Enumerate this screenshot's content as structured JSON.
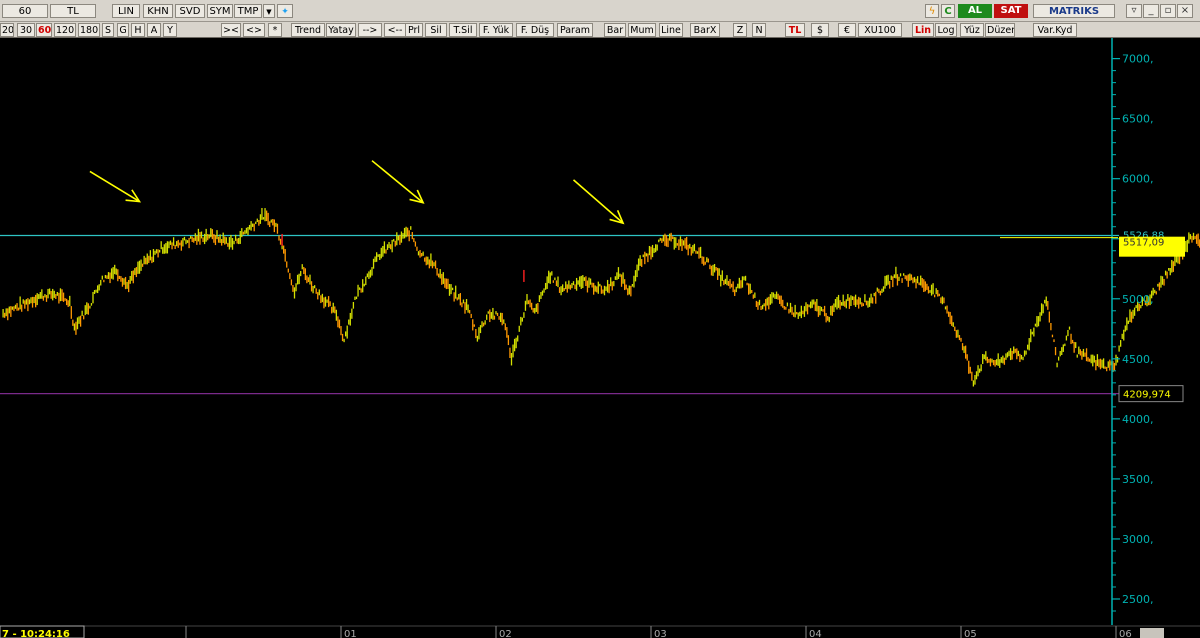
{
  "toolbar_top": {
    "period": "60",
    "currency": "TL",
    "buttons": [
      "LIN",
      "KHN",
      "SVD",
      "SYM",
      "TMP"
    ],
    "buy": "AL",
    "sell": "SAT",
    "brand": "MATRIKS",
    "brand_color": "#1a3a8a",
    "buy_color": "#1d8a1d",
    "sell_color": "#c01010"
  },
  "toolbar_periods": [
    "20",
    "30",
    "60",
    "120",
    "180",
    "S",
    "G",
    "H",
    "A",
    "Y"
  ],
  "active_period": "60",
  "toolbar_tools": [
    "><",
    "<>",
    "*",
    "Trend",
    "Yatay",
    "-->",
    "<--",
    "Prl",
    "Sil",
    "T.Sil",
    "F. Yük",
    "F. Düş",
    "Param",
    "Bar",
    "Mum",
    "Line",
    "BarX",
    "Z",
    "N",
    "TL",
    "$",
    "€",
    "XU100",
    "Lin",
    "Log",
    "Yüz",
    "Düzen",
    "Var.Kyd"
  ],
  "status": {
    "time": "7 - 10:24:16"
  },
  "chart_data": {
    "type": "line",
    "symbol": "XU100",
    "scale": "linear",
    "ylim": [
      2350,
      7130
    ],
    "y_ticks": [
      7000,
      6500,
      6000,
      5500,
      5000,
      4500,
      4000,
      3500,
      3000,
      2500
    ],
    "y_tick_labels": [
      "7000,",
      "6500,",
      "6000,",
      "5500,",
      "5000,",
      "4500,",
      "4000,",
      "3500,",
      "3000,",
      "2500,"
    ],
    "x_ticks": [
      {
        "x": 0.0,
        "label": ""
      },
      {
        "x": 1.0,
        "label": "01"
      },
      {
        "x": 2.0,
        "label": "02"
      },
      {
        "x": 3.0,
        "label": "03"
      },
      {
        "x": 4.0,
        "label": "04"
      },
      {
        "x": 5.0,
        "label": "05"
      },
      {
        "x": 6.0,
        "label": "06"
      }
    ],
    "series": [
      {
        "values": [
          [
            -1.18,
            4880
          ],
          [
            -1.05,
            4950
          ],
          [
            -0.95,
            5020
          ],
          [
            -0.85,
            5040
          ],
          [
            -0.75,
            4970
          ],
          [
            -0.72,
            4760
          ],
          [
            -0.62,
            4950
          ],
          [
            -0.55,
            5150
          ],
          [
            -0.45,
            5240
          ],
          [
            -0.38,
            5110
          ],
          [
            -0.3,
            5260
          ],
          [
            -0.15,
            5430
          ],
          [
            0.0,
            5480
          ],
          [
            0.15,
            5530
          ],
          [
            0.3,
            5460
          ],
          [
            0.4,
            5580
          ],
          [
            0.5,
            5690
          ],
          [
            0.58,
            5610
          ],
          [
            0.62,
            5460
          ],
          [
            0.7,
            5060
          ],
          [
            0.75,
            5250
          ],
          [
            0.82,
            5100
          ],
          [
            0.9,
            4980
          ],
          [
            0.97,
            4870
          ],
          [
            1.02,
            4660
          ],
          [
            1.1,
            5030
          ],
          [
            1.25,
            5370
          ],
          [
            1.4,
            5520
          ],
          [
            1.45,
            5560
          ],
          [
            1.5,
            5400
          ],
          [
            1.6,
            5280
          ],
          [
            1.7,
            5080
          ],
          [
            1.82,
            4920
          ],
          [
            1.88,
            4690
          ],
          [
            1.95,
            4880
          ],
          [
            2.05,
            4830
          ],
          [
            2.1,
            4510
          ],
          [
            2.2,
            4980
          ],
          [
            2.25,
            4880
          ],
          [
            2.35,
            5200
          ],
          [
            2.42,
            5080
          ],
          [
            2.55,
            5150
          ],
          [
            2.7,
            5070
          ],
          [
            2.8,
            5200
          ],
          [
            2.86,
            5050
          ],
          [
            2.93,
            5300
          ],
          [
            3.05,
            5470
          ],
          [
            3.15,
            5490
          ],
          [
            3.3,
            5390
          ],
          [
            3.45,
            5180
          ],
          [
            3.55,
            5060
          ],
          [
            3.6,
            5170
          ],
          [
            3.7,
            4940
          ],
          [
            3.8,
            5010
          ],
          [
            3.95,
            4860
          ],
          [
            4.05,
            4950
          ],
          [
            4.15,
            4850
          ],
          [
            4.2,
            4960
          ],
          [
            4.3,
            5000
          ],
          [
            4.4,
            4970
          ],
          [
            4.5,
            5100
          ],
          [
            4.58,
            5190
          ],
          [
            4.7,
            5160
          ],
          [
            4.8,
            5090
          ],
          [
            4.9,
            4950
          ],
          [
            4.95,
            4790
          ],
          [
            5.02,
            4580
          ],
          [
            5.08,
            4320
          ],
          [
            5.15,
            4500
          ],
          [
            5.25,
            4460
          ],
          [
            5.32,
            4560
          ],
          [
            5.4,
            4500
          ],
          [
            5.45,
            4680
          ],
          [
            5.55,
            5000
          ],
          [
            5.62,
            4470
          ],
          [
            5.7,
            4730
          ],
          [
            5.75,
            4550
          ],
          [
            5.85,
            4480
          ],
          [
            5.95,
            4430
          ],
          [
            6.0,
            4470
          ],
          [
            6.05,
            4720
          ],
          [
            6.12,
            4920
          ],
          [
            6.22,
            5000
          ],
          [
            6.35,
            5240
          ],
          [
            6.42,
            5380
          ],
          [
            6.5,
            5540
          ],
          [
            6.55,
            5470
          ],
          [
            6.62,
            5540
          ],
          [
            6.68,
            5700
          ],
          [
            6.72,
            5630
          ],
          [
            6.75,
            5517
          ]
        ]
      }
    ],
    "reference_lines": [
      {
        "label": "5526,88",
        "value": 5526.88,
        "color": "#2ec4c4"
      },
      {
        "label": "4209,974",
        "value": 4209.974,
        "color": "#7a2a8a"
      }
    ],
    "last_price": {
      "label": "5517,09",
      "value": 5517.09,
      "color": "#ffff00"
    },
    "annotations": [
      {
        "type": "arrow",
        "from": [
          -0.62,
          6060
        ],
        "to": [
          -0.3,
          5810
        ],
        "color": "#ffff00"
      },
      {
        "type": "arrow",
        "from": [
          1.2,
          6150
        ],
        "to": [
          1.53,
          5800
        ],
        "color": "#ffff00"
      },
      {
        "type": "arrow",
        "from": [
          2.5,
          5990
        ],
        "to": [
          2.82,
          5630
        ],
        "color": "#ffff00"
      },
      {
        "type": "arrow",
        "from": [
          6.78,
          5040
        ],
        "to": [
          6.55,
          5420
        ],
        "color": "#ffff00"
      }
    ],
    "colors": {
      "up": "#d4e000",
      "down": "#ff9900",
      "background": "#000000",
      "axis": "#00b3b3"
    }
  }
}
